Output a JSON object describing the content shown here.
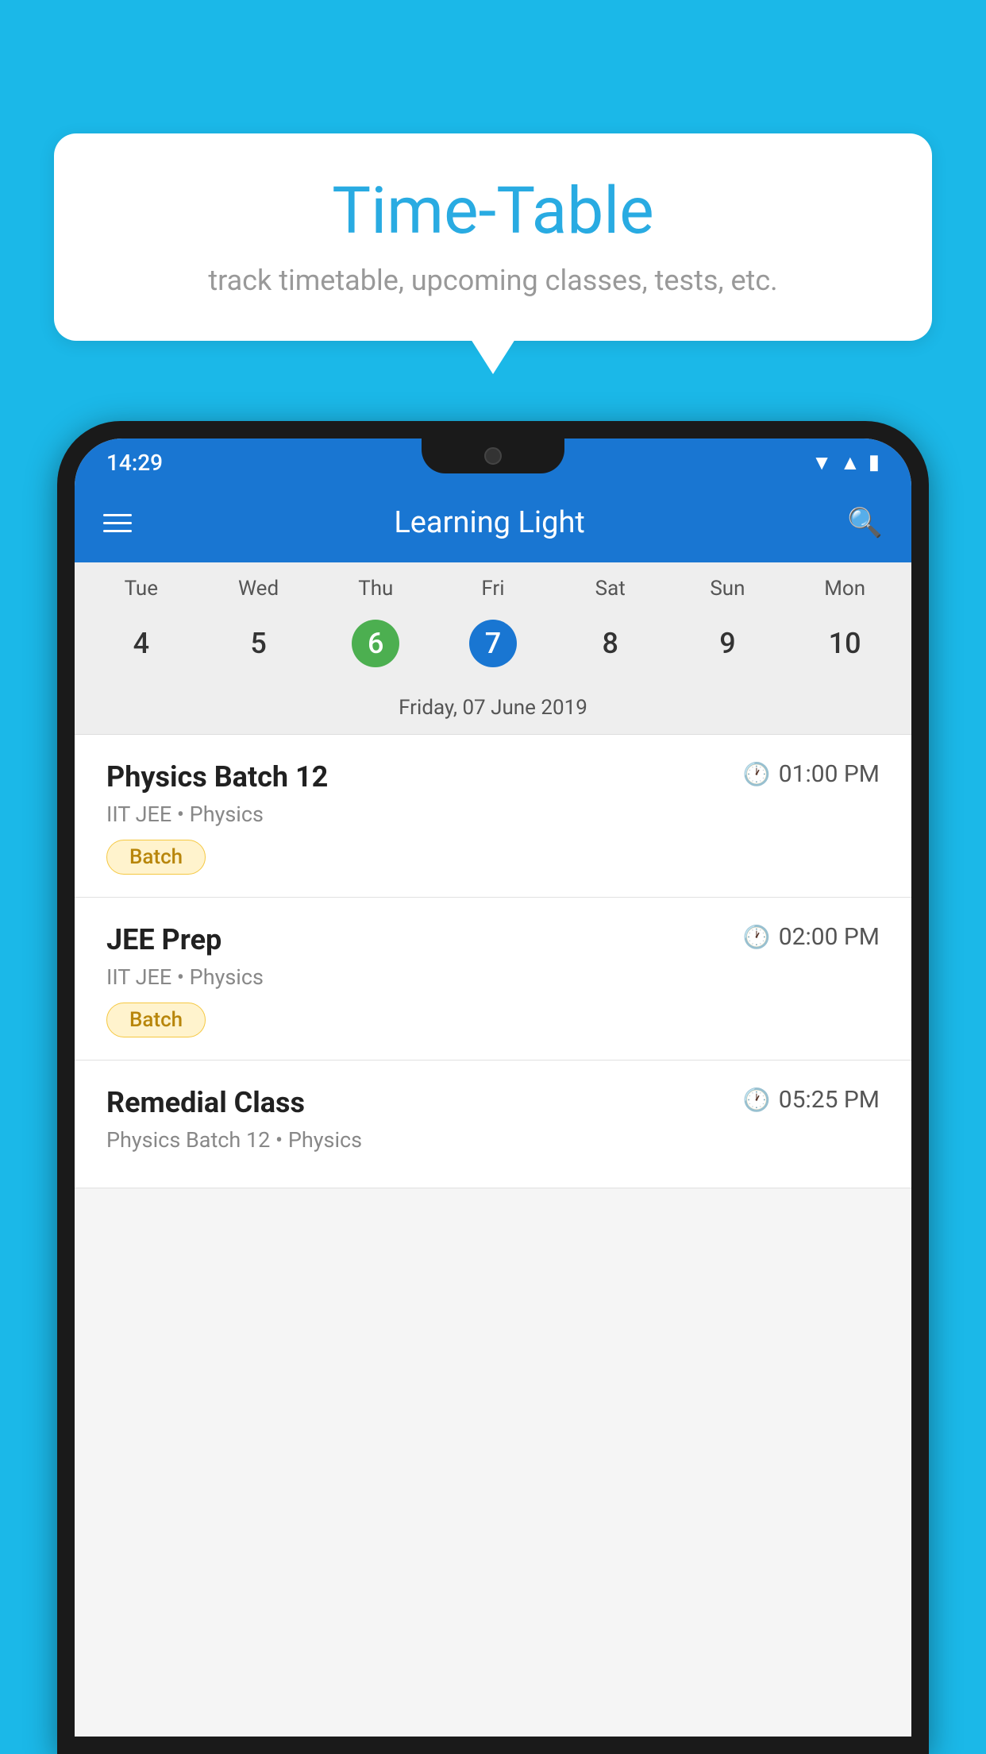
{
  "background_color": "#1BB8E8",
  "bubble": {
    "title": "Time-Table",
    "subtitle": "track timetable, upcoming classes, tests, etc."
  },
  "phone": {
    "status_bar": {
      "time": "14:29"
    },
    "app_bar": {
      "title": "Learning Light"
    },
    "calendar": {
      "days": [
        "Tue",
        "Wed",
        "Thu",
        "Fri",
        "Sat",
        "Sun",
        "Mon"
      ],
      "dates": [
        "4",
        "5",
        "6",
        "7",
        "8",
        "9",
        "10"
      ],
      "today_index": 2,
      "selected_index": 3,
      "selected_label": "Friday, 07 June 2019"
    },
    "schedule": [
      {
        "title": "Physics Batch 12",
        "time": "01:00 PM",
        "subtitle": "IIT JEE • Physics",
        "badge": "Batch"
      },
      {
        "title": "JEE Prep",
        "time": "02:00 PM",
        "subtitle": "IIT JEE • Physics",
        "badge": "Batch"
      },
      {
        "title": "Remedial Class",
        "time": "05:25 PM",
        "subtitle": "Physics Batch 12 • Physics",
        "badge": null
      }
    ]
  }
}
